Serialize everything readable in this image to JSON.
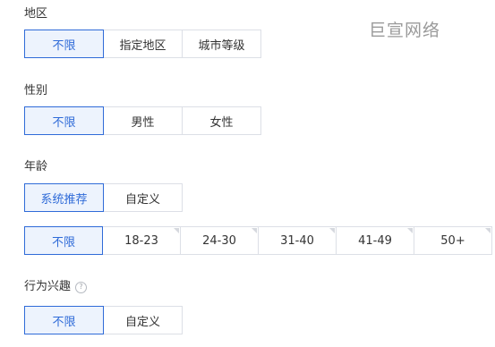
{
  "watermark": "巨宣网络",
  "region": {
    "label": "地区",
    "options": [
      "不限",
      "指定地区",
      "城市等级"
    ],
    "selected": 0
  },
  "gender": {
    "label": "性别",
    "options": [
      "不限",
      "男性",
      "女性"
    ],
    "selected": 0
  },
  "age": {
    "label": "年龄",
    "modes": [
      "系统推荐",
      "自定义"
    ],
    "selected_mode": 0,
    "ranges": [
      "不限",
      "18-23",
      "24-30",
      "31-40",
      "41-49",
      "50+"
    ],
    "selected_range": 0
  },
  "interest": {
    "label": "行为兴趣",
    "help_icon": "question-circle-icon",
    "options": [
      "不限",
      "自定义"
    ],
    "selected": 0
  },
  "colors": {
    "accent": "#2f6bd8",
    "selected_bg": "#edf3fd",
    "border": "#dcdfe6"
  }
}
